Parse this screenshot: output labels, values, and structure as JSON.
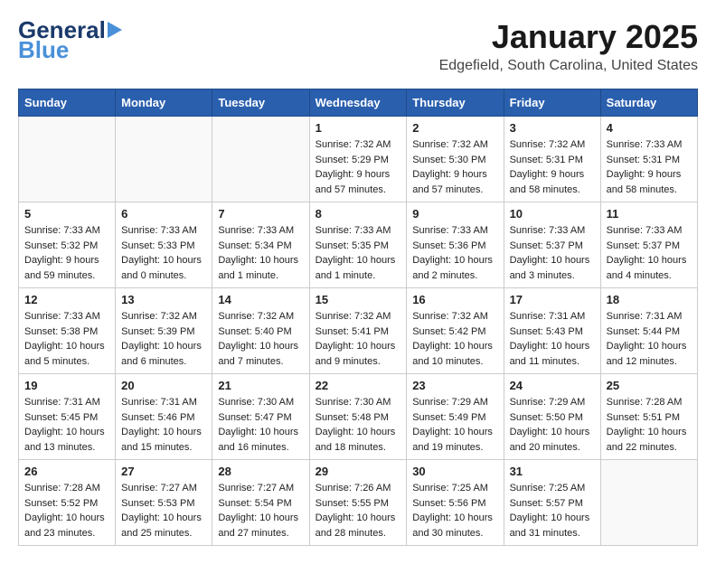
{
  "header": {
    "logo_general": "General",
    "logo_blue": "Blue",
    "month_title": "January 2025",
    "location": "Edgefield, South Carolina, United States"
  },
  "weekdays": [
    "Sunday",
    "Monday",
    "Tuesday",
    "Wednesday",
    "Thursday",
    "Friday",
    "Saturday"
  ],
  "weeks": [
    [
      {
        "day": "",
        "sunrise": "",
        "sunset": "",
        "daylight": ""
      },
      {
        "day": "",
        "sunrise": "",
        "sunset": "",
        "daylight": ""
      },
      {
        "day": "",
        "sunrise": "",
        "sunset": "",
        "daylight": ""
      },
      {
        "day": "1",
        "sunrise": "Sunrise: 7:32 AM",
        "sunset": "Sunset: 5:29 PM",
        "daylight": "Daylight: 9 hours and 57 minutes."
      },
      {
        "day": "2",
        "sunrise": "Sunrise: 7:32 AM",
        "sunset": "Sunset: 5:30 PM",
        "daylight": "Daylight: 9 hours and 57 minutes."
      },
      {
        "day": "3",
        "sunrise": "Sunrise: 7:32 AM",
        "sunset": "Sunset: 5:31 PM",
        "daylight": "Daylight: 9 hours and 58 minutes."
      },
      {
        "day": "4",
        "sunrise": "Sunrise: 7:33 AM",
        "sunset": "Sunset: 5:31 PM",
        "daylight": "Daylight: 9 hours and 58 minutes."
      }
    ],
    [
      {
        "day": "5",
        "sunrise": "Sunrise: 7:33 AM",
        "sunset": "Sunset: 5:32 PM",
        "daylight": "Daylight: 9 hours and 59 minutes."
      },
      {
        "day": "6",
        "sunrise": "Sunrise: 7:33 AM",
        "sunset": "Sunset: 5:33 PM",
        "daylight": "Daylight: 10 hours and 0 minutes."
      },
      {
        "day": "7",
        "sunrise": "Sunrise: 7:33 AM",
        "sunset": "Sunset: 5:34 PM",
        "daylight": "Daylight: 10 hours and 1 minute."
      },
      {
        "day": "8",
        "sunrise": "Sunrise: 7:33 AM",
        "sunset": "Sunset: 5:35 PM",
        "daylight": "Daylight: 10 hours and 1 minute."
      },
      {
        "day": "9",
        "sunrise": "Sunrise: 7:33 AM",
        "sunset": "Sunset: 5:36 PM",
        "daylight": "Daylight: 10 hours and 2 minutes."
      },
      {
        "day": "10",
        "sunrise": "Sunrise: 7:33 AM",
        "sunset": "Sunset: 5:37 PM",
        "daylight": "Daylight: 10 hours and 3 minutes."
      },
      {
        "day": "11",
        "sunrise": "Sunrise: 7:33 AM",
        "sunset": "Sunset: 5:37 PM",
        "daylight": "Daylight: 10 hours and 4 minutes."
      }
    ],
    [
      {
        "day": "12",
        "sunrise": "Sunrise: 7:33 AM",
        "sunset": "Sunset: 5:38 PM",
        "daylight": "Daylight: 10 hours and 5 minutes."
      },
      {
        "day": "13",
        "sunrise": "Sunrise: 7:32 AM",
        "sunset": "Sunset: 5:39 PM",
        "daylight": "Daylight: 10 hours and 6 minutes."
      },
      {
        "day": "14",
        "sunrise": "Sunrise: 7:32 AM",
        "sunset": "Sunset: 5:40 PM",
        "daylight": "Daylight: 10 hours and 7 minutes."
      },
      {
        "day": "15",
        "sunrise": "Sunrise: 7:32 AM",
        "sunset": "Sunset: 5:41 PM",
        "daylight": "Daylight: 10 hours and 9 minutes."
      },
      {
        "day": "16",
        "sunrise": "Sunrise: 7:32 AM",
        "sunset": "Sunset: 5:42 PM",
        "daylight": "Daylight: 10 hours and 10 minutes."
      },
      {
        "day": "17",
        "sunrise": "Sunrise: 7:31 AM",
        "sunset": "Sunset: 5:43 PM",
        "daylight": "Daylight: 10 hours and 11 minutes."
      },
      {
        "day": "18",
        "sunrise": "Sunrise: 7:31 AM",
        "sunset": "Sunset: 5:44 PM",
        "daylight": "Daylight: 10 hours and 12 minutes."
      }
    ],
    [
      {
        "day": "19",
        "sunrise": "Sunrise: 7:31 AM",
        "sunset": "Sunset: 5:45 PM",
        "daylight": "Daylight: 10 hours and 13 minutes."
      },
      {
        "day": "20",
        "sunrise": "Sunrise: 7:31 AM",
        "sunset": "Sunset: 5:46 PM",
        "daylight": "Daylight: 10 hours and 15 minutes."
      },
      {
        "day": "21",
        "sunrise": "Sunrise: 7:30 AM",
        "sunset": "Sunset: 5:47 PM",
        "daylight": "Daylight: 10 hours and 16 minutes."
      },
      {
        "day": "22",
        "sunrise": "Sunrise: 7:30 AM",
        "sunset": "Sunset: 5:48 PM",
        "daylight": "Daylight: 10 hours and 18 minutes."
      },
      {
        "day": "23",
        "sunrise": "Sunrise: 7:29 AM",
        "sunset": "Sunset: 5:49 PM",
        "daylight": "Daylight: 10 hours and 19 minutes."
      },
      {
        "day": "24",
        "sunrise": "Sunrise: 7:29 AM",
        "sunset": "Sunset: 5:50 PM",
        "daylight": "Daylight: 10 hours and 20 minutes."
      },
      {
        "day": "25",
        "sunrise": "Sunrise: 7:28 AM",
        "sunset": "Sunset: 5:51 PM",
        "daylight": "Daylight: 10 hours and 22 minutes."
      }
    ],
    [
      {
        "day": "26",
        "sunrise": "Sunrise: 7:28 AM",
        "sunset": "Sunset: 5:52 PM",
        "daylight": "Daylight: 10 hours and 23 minutes."
      },
      {
        "day": "27",
        "sunrise": "Sunrise: 7:27 AM",
        "sunset": "Sunset: 5:53 PM",
        "daylight": "Daylight: 10 hours and 25 minutes."
      },
      {
        "day": "28",
        "sunrise": "Sunrise: 7:27 AM",
        "sunset": "Sunset: 5:54 PM",
        "daylight": "Daylight: 10 hours and 27 minutes."
      },
      {
        "day": "29",
        "sunrise": "Sunrise: 7:26 AM",
        "sunset": "Sunset: 5:55 PM",
        "daylight": "Daylight: 10 hours and 28 minutes."
      },
      {
        "day": "30",
        "sunrise": "Sunrise: 7:25 AM",
        "sunset": "Sunset: 5:56 PM",
        "daylight": "Daylight: 10 hours and 30 minutes."
      },
      {
        "day": "31",
        "sunrise": "Sunrise: 7:25 AM",
        "sunset": "Sunset: 5:57 PM",
        "daylight": "Daylight: 10 hours and 31 minutes."
      },
      {
        "day": "",
        "sunrise": "",
        "sunset": "",
        "daylight": ""
      }
    ]
  ]
}
